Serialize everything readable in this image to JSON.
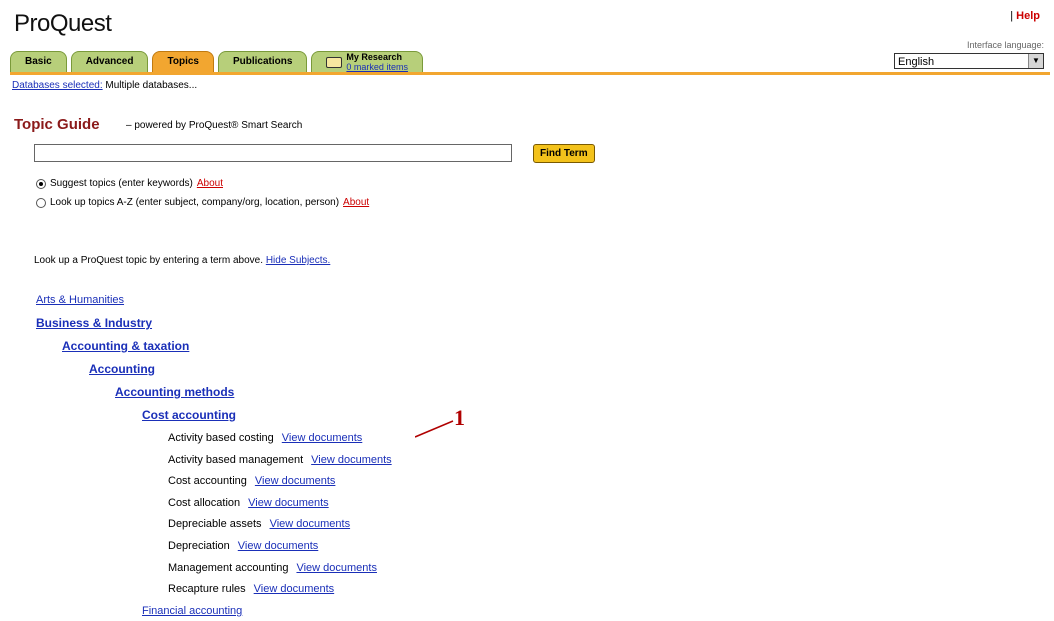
{
  "header": {
    "logo": "ProQuest",
    "help_sep": "|",
    "help": "Help",
    "interface_language_label": "Interface language:",
    "interface_language_value": "English"
  },
  "tabs": [
    {
      "label": "Basic"
    },
    {
      "label": "Advanced"
    },
    {
      "label": "Topics",
      "active": true
    },
    {
      "label": "Publications"
    },
    {
      "label": "My Research",
      "sub": "0 marked items"
    }
  ],
  "databases": {
    "label": "Databases selected:",
    "value": "Multiple databases..."
  },
  "topic_guide": {
    "title": "Topic Guide",
    "subtitle": "– powered by ProQuest® Smart Search",
    "search_value": "",
    "find_button": "Find Term",
    "radio_suggest": "Suggest topics (enter keywords)",
    "radio_lookup": "Look up topics A-Z (enter subject, company/org, location, person)",
    "about": "About",
    "lookup_text": "Look up a ProQuest topic by entering a term above.",
    "hide_subjects": "Hide Subjects."
  },
  "tree": {
    "arts": "Arts & Humanities",
    "business": "Business & Industry",
    "accounting_taxation": "Accounting & taxation",
    "accounting": "Accounting",
    "accounting_methods": "Accounting methods",
    "cost_accounting": "Cost accounting",
    "view_documents": "View documents",
    "leaves": [
      "Activity based costing",
      "Activity based management",
      "Cost accounting",
      "Cost allocation",
      "Depreciable assets",
      "Depreciation",
      "Management accounting",
      "Recapture rules"
    ],
    "financial_accounting": "Financial accounting"
  },
  "annotation": {
    "number": "1"
  }
}
